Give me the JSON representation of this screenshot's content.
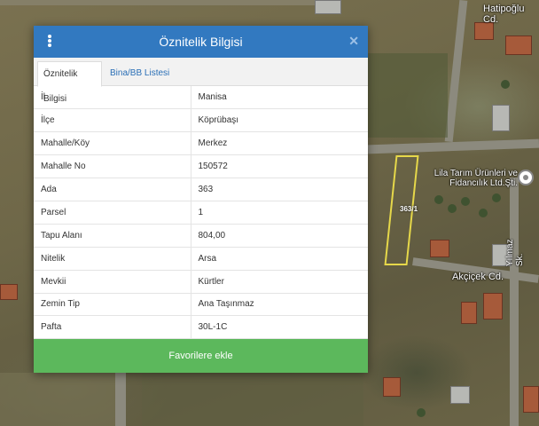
{
  "dialog": {
    "title": "Öznitelik Bilgisi",
    "menu_icon": "vertical-dots-icon",
    "close_icon": "close-icon",
    "tabs": [
      {
        "label": "Öznitelik Bilgisi",
        "active": true
      },
      {
        "label": "Bina/BB Listesi",
        "active": false
      }
    ],
    "rows": [
      {
        "key": "İl",
        "value": "Manisa"
      },
      {
        "key": "İlçe",
        "value": "Köprübaşı"
      },
      {
        "key": "Mahalle/Köy",
        "value": "Merkez"
      },
      {
        "key": "Mahalle No",
        "value": "150572"
      },
      {
        "key": "Ada",
        "value": "363"
      },
      {
        "key": "Parsel",
        "value": "1"
      },
      {
        "key": "Tapu Alanı",
        "value": "804,00"
      },
      {
        "key": "Nitelik",
        "value": "Arsa"
      },
      {
        "key": "Mevkii",
        "value": "Kürtler"
      },
      {
        "key": "Zemin Tip",
        "value": "Ana Taşınmaz"
      },
      {
        "key": "Pafta",
        "value": "30L-1C"
      }
    ],
    "favorite_button": "Favorilere ekle",
    "colors": {
      "header": "#3279c0",
      "button": "#5cb85c",
      "tab_link": "#2a6fb6"
    }
  },
  "map": {
    "labels": {
      "street_hatipoglu": "Hatipoğlu Cd.",
      "business": "Lila Tarım Ürünleri ve Fidancılık Ltd.Şti.",
      "street_yilmaz": "Yılmaz Sk.",
      "street_akcicek": "Akçiçek Cd."
    },
    "parcel_label": "363/1",
    "parcel_color": "#e6d84a",
    "poi_icon": "map-pin-icon"
  }
}
